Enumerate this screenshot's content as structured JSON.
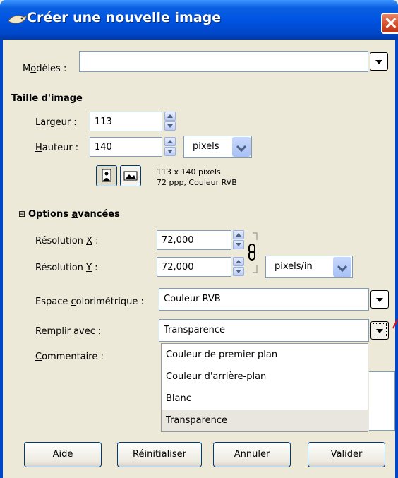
{
  "window": {
    "title": "Créer une nouvelle image"
  },
  "templates": {
    "label_prefix": "M",
    "label_underlined": "o",
    "label_rest": "dèles :",
    "value": ""
  },
  "image_size": {
    "heading": "Taille d'image",
    "width": {
      "label_underlined": "L",
      "label_rest": "argeur :",
      "value": "113"
    },
    "height": {
      "label_underlined": "H",
      "label_rest": "auteur :",
      "value": "140"
    },
    "unit": "pixels",
    "info_line1": "113 x 140 pixels",
    "info_line2": "72 ppp, Couleur RVB"
  },
  "advanced": {
    "toggle": "⊟",
    "heading_prefix": "Options ",
    "heading_underlined": "a",
    "heading_rest": "vancées",
    "res_x": {
      "label_prefix": "Résolution ",
      "label_underlined": "X",
      "label_rest": " :",
      "value": "72,000"
    },
    "res_y": {
      "label_prefix": "Résolution ",
      "label_underlined": "Y",
      "label_rest": " :",
      "value": "72,000"
    },
    "res_unit": "pixels/in",
    "colorspace": {
      "label_prefix": "Espace ",
      "label_underlined": "c",
      "label_rest": "olorimétrique :",
      "value": "Couleur RVB"
    },
    "fill": {
      "label_underlined": "R",
      "label_rest": "emplir avec :",
      "value": "Transparence"
    },
    "comment": {
      "label_underlined": "C",
      "label_rest": "ommentaire :"
    },
    "fill_options": [
      "Couleur de premier plan",
      "Couleur d'arrière-plan",
      "Blanc",
      "Transparence"
    ],
    "fill_selected_index": 3
  },
  "buttons": {
    "help": {
      "underlined": "A",
      "rest": "ide"
    },
    "reset": {
      "underlined": "R",
      "rest": "éinitialiser"
    },
    "cancel": {
      "prefix": "A",
      "underlined": "n",
      "rest": "nuler"
    },
    "ok": {
      "underlined": "V",
      "rest": "alider"
    }
  },
  "colors": {
    "titlebar": "#0054e3",
    "dialog_bg": "#ece9d8",
    "pointer_mark": "#e01010"
  }
}
